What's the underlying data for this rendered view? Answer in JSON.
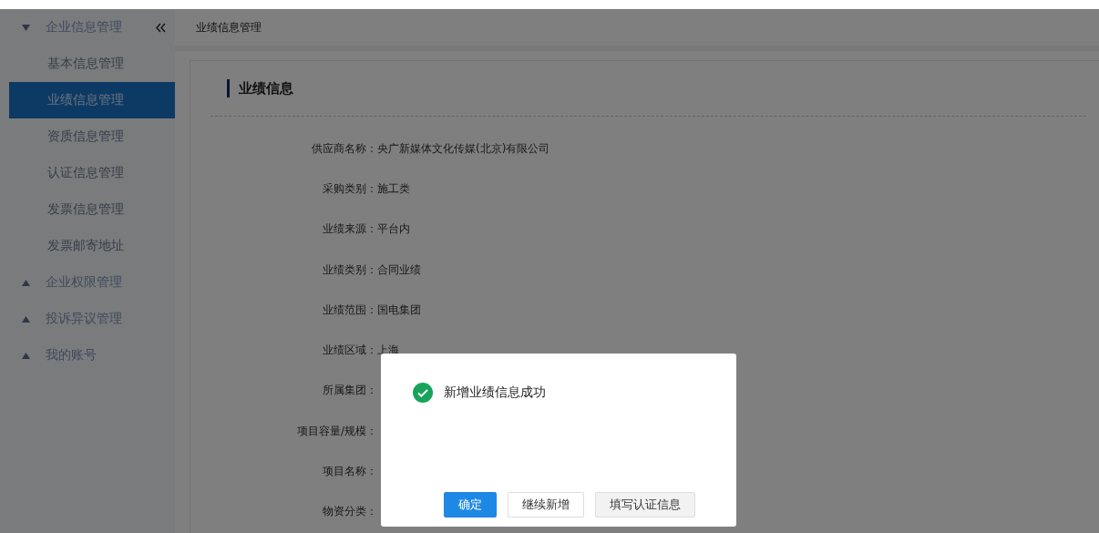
{
  "sidebar": {
    "groups": [
      {
        "label": "企业信息管理",
        "expanded": true,
        "children": [
          {
            "label": "基本信息管理",
            "selected": false
          },
          {
            "label": "业绩信息管理",
            "selected": true
          },
          {
            "label": "资质信息管理",
            "selected": false
          },
          {
            "label": "认证信息管理",
            "selected": false
          },
          {
            "label": "发票信息管理",
            "selected": false
          },
          {
            "label": "发票邮寄地址",
            "selected": false
          }
        ]
      },
      {
        "label": "企业权限管理",
        "expanded": false
      },
      {
        "label": "投诉异议管理",
        "expanded": false
      },
      {
        "label": "我的账号",
        "expanded": false
      }
    ]
  },
  "breadcrumb": "业绩信息管理",
  "section_title": "业绩信息",
  "fields": [
    {
      "label": "供应商名称：",
      "value": "央广新媒体文化传媒(北京)有限公司"
    },
    {
      "label": "采购类别：",
      "value": "施工类"
    },
    {
      "label": "业绩来源：",
      "value": "平台内"
    },
    {
      "label": "业绩类别：",
      "value": "合同业绩"
    },
    {
      "label": "业绩范围：",
      "value": "国电集团"
    },
    {
      "label": "业绩区域：",
      "value": "上海"
    },
    {
      "label": "所属集团："
    },
    {
      "label": "项目容量/规模："
    },
    {
      "label": "项目名称："
    },
    {
      "label": "物资分类："
    }
  ],
  "dialog": {
    "message": "新增业绩信息成功",
    "buttons": [
      {
        "label": "确定",
        "kind": "primary"
      },
      {
        "label": "继续新增",
        "kind": "default"
      },
      {
        "label": "填写认证信息",
        "kind": "muted"
      }
    ]
  }
}
